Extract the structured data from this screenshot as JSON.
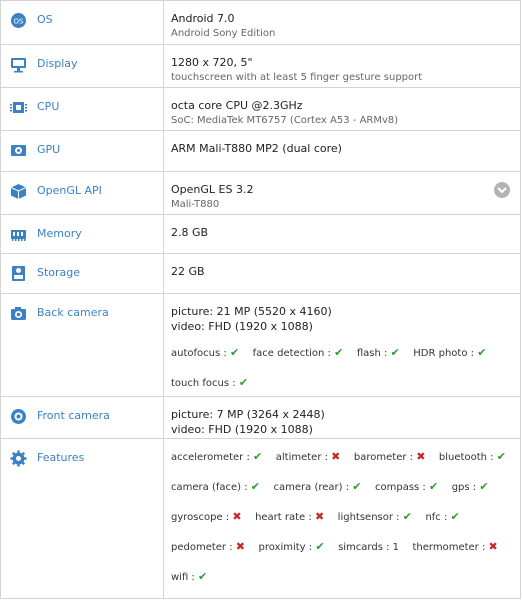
{
  "rows": {
    "os": {
      "label": "OS",
      "line1": "Android 7.0",
      "line2": "Android Sony Edition"
    },
    "display": {
      "label": "Display",
      "line1": "1280 x 720, 5\"",
      "line2": "touchscreen with at least 5 finger gesture support"
    },
    "cpu": {
      "label": "CPU",
      "line1": "octa core CPU @2.3GHz",
      "line2": "SoC: MediaTek MT6757 (Cortex A53 - ARMv8)"
    },
    "gpu": {
      "label": "GPU",
      "line1": "ARM Mali-T880 MP2 (dual core)"
    },
    "opengl": {
      "label": "OpenGL API",
      "line1": "OpenGL ES 3.2",
      "line2": "Mali-T880"
    },
    "memory": {
      "label": "Memory",
      "line1": "2.8 GB"
    },
    "storage": {
      "label": "Storage",
      "line1": "22 GB"
    },
    "back_camera": {
      "label": "Back camera",
      "line1": "picture: 21 MP (5520 x 4160)",
      "line2": "video: FHD (1920 x 1088)",
      "features": [
        {
          "name": "autofocus :",
          "ok": true
        },
        {
          "name": "face detection :",
          "ok": true
        },
        {
          "name": "flash :",
          "ok": true
        },
        {
          "name": "HDR photo :",
          "ok": true
        },
        {
          "name": "touch focus :",
          "ok": true
        }
      ]
    },
    "front_camera": {
      "label": "Front camera",
      "line1": "picture: 7 MP (3264 x 2448)",
      "line2": "video: FHD (1920 x 1088)"
    },
    "features": {
      "label": "Features",
      "items": [
        {
          "name": "accelerometer :",
          "ok": true
        },
        {
          "name": "altimeter :",
          "ok": false
        },
        {
          "name": "barometer :",
          "ok": false
        },
        {
          "name": "bluetooth :",
          "ok": true
        },
        {
          "name": "camera (face) :",
          "ok": true
        },
        {
          "name": "camera (rear) :",
          "ok": true
        },
        {
          "name": "compass :",
          "ok": true
        },
        {
          "name": "gps :",
          "ok": true
        },
        {
          "name": "gyroscope :",
          "ok": false
        },
        {
          "name": "heart rate :",
          "ok": false
        },
        {
          "name": "lightsensor :",
          "ok": true
        },
        {
          "name": "nfc :",
          "ok": true
        },
        {
          "name": "pedometer :",
          "ok": false
        },
        {
          "name": "proximity :",
          "ok": true
        },
        {
          "name": "simcards : 1",
          "ok": null
        },
        {
          "name": "thermometer :",
          "ok": false
        },
        {
          "name": "wifi :",
          "ok": true
        }
      ]
    }
  },
  "icons": {
    "os": "os-icon",
    "display": "monitor-icon",
    "cpu": "cpu-chip-icon",
    "gpu": "gpu-card-icon",
    "opengl": "cube-icon",
    "memory": "memory-module-icon",
    "storage": "storage-drive-icon",
    "back_camera": "camera-icon",
    "front_camera": "front-camera-icon",
    "features": "gear-icon",
    "expand": "chevron-down-icon"
  },
  "colors": {
    "label": "#3a82c4",
    "ok": "#2e9b2e",
    "no": "#c62828",
    "border": "#d4d4d4"
  }
}
